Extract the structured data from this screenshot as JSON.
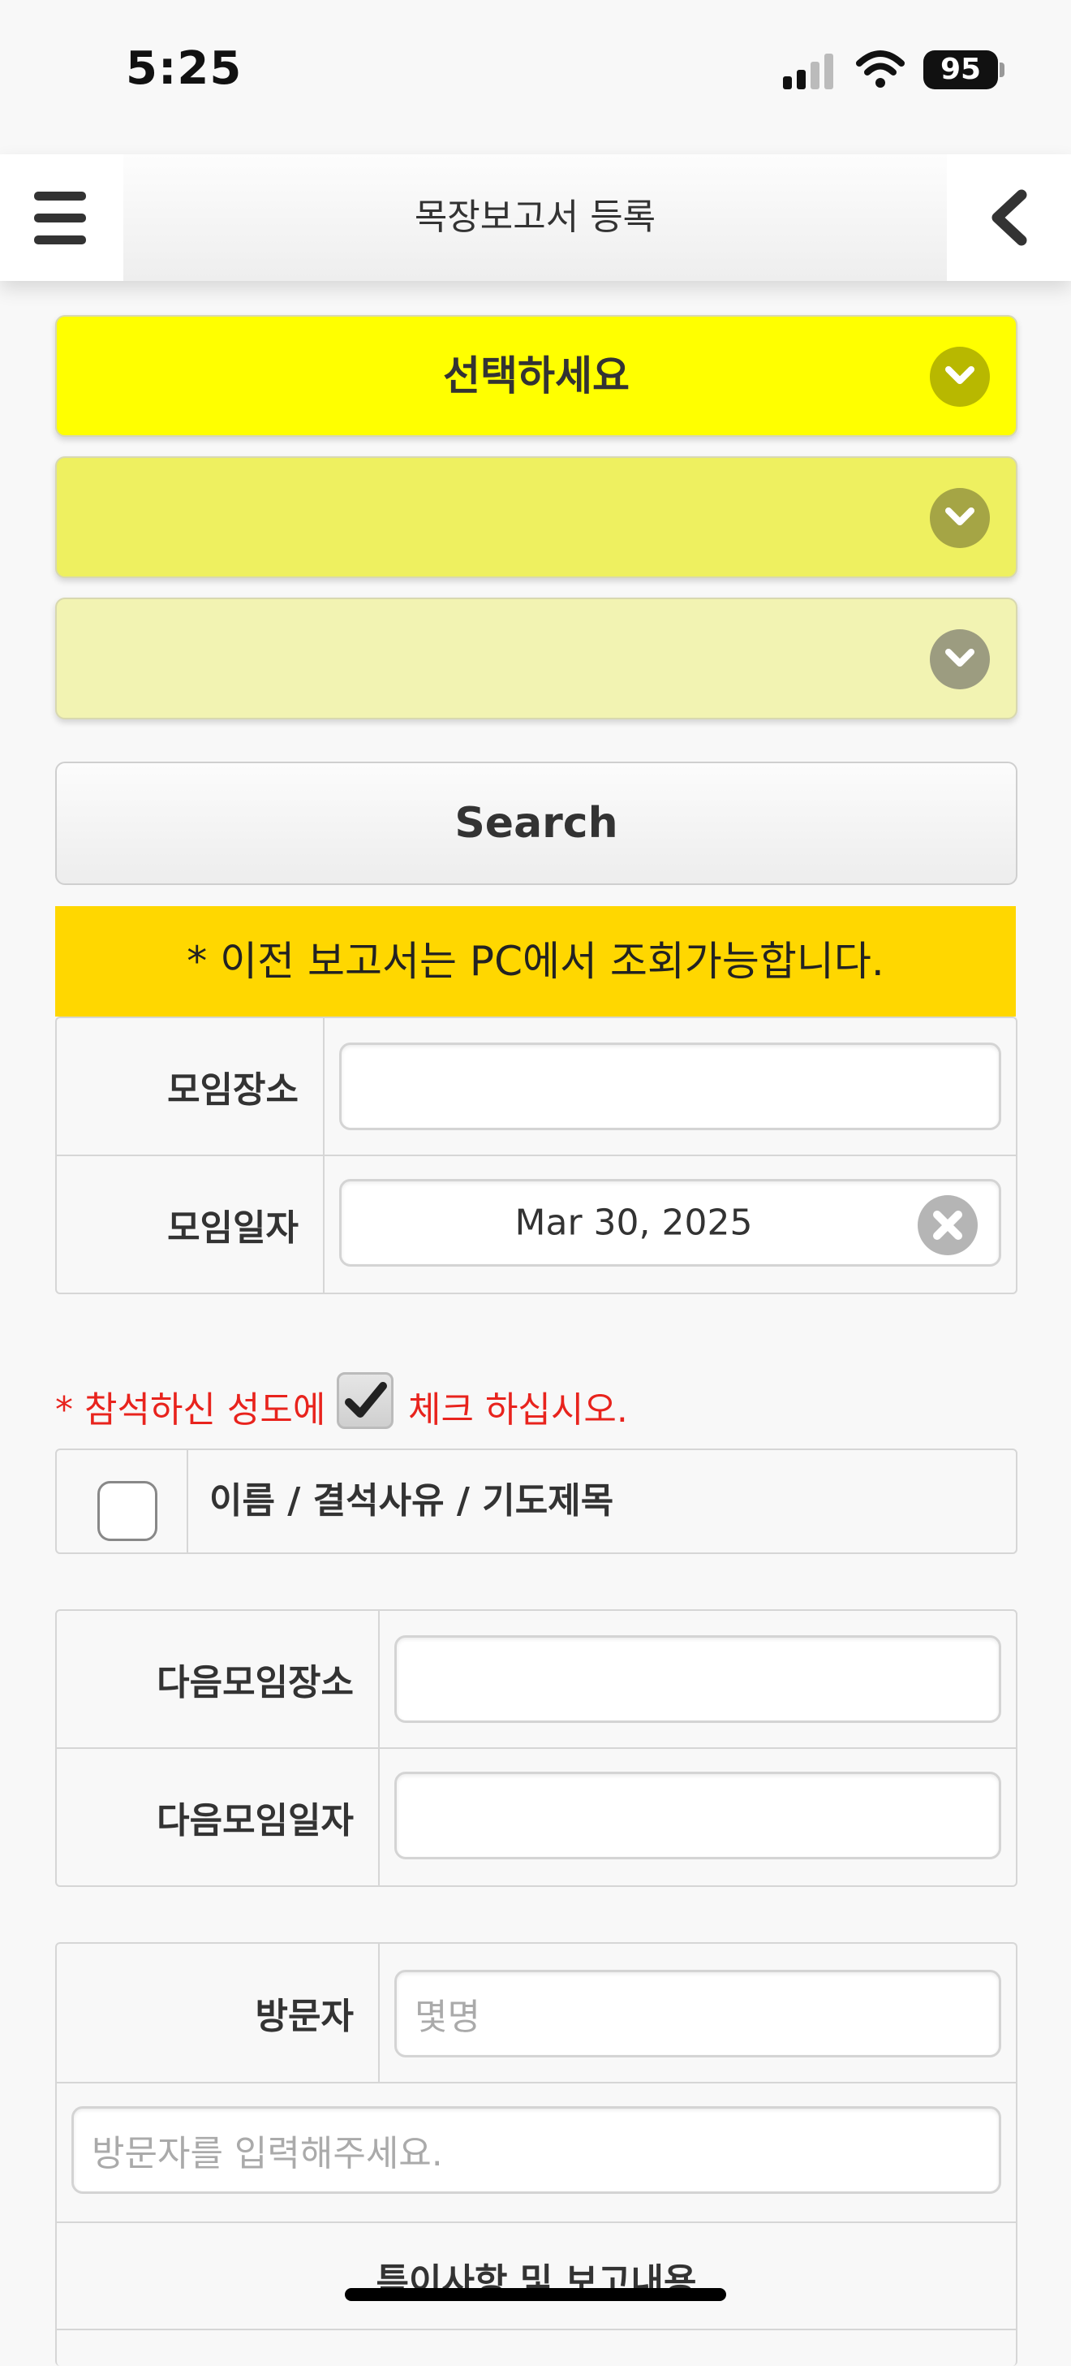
{
  "status_bar": {
    "time": "5:25",
    "battery": "95"
  },
  "header": {
    "title": "목장보고서 등록"
  },
  "selects": [
    {
      "label": "선택하세요",
      "color": "#ffff00",
      "chevron_color": "#b8b800"
    },
    {
      "label": "",
      "color": "#eef060",
      "chevron_color": "#a5a545"
    },
    {
      "label": "",
      "color": "#f2f3b2",
      "chevron_color": "#9c9c80"
    }
  ],
  "search": {
    "label": "Search"
  },
  "notice": {
    "text": "* 이전 보고서는 PC에서 조회가능합니다."
  },
  "meeting": {
    "place_label": "모임장소",
    "place_value": "",
    "date_label": "모임일자",
    "date_value": "Mar 30, 2025"
  },
  "attendance": {
    "note_prefix": "* 참석하신 성도에",
    "note_suffix": "체크 하십시오.",
    "header": "이름 / 결석사유 / 기도제목"
  },
  "next_meeting": {
    "place_label": "다음모임장소",
    "date_label": "다음모임일자"
  },
  "visitors": {
    "label": "방문자",
    "count_placeholder": "몇명",
    "names_placeholder": "방문자를 입력해주세요.",
    "report_title": "특이사항 및 보고내용"
  },
  "colors": {
    "notice_bg": "#ffd700",
    "note_red": "#e8231d"
  }
}
